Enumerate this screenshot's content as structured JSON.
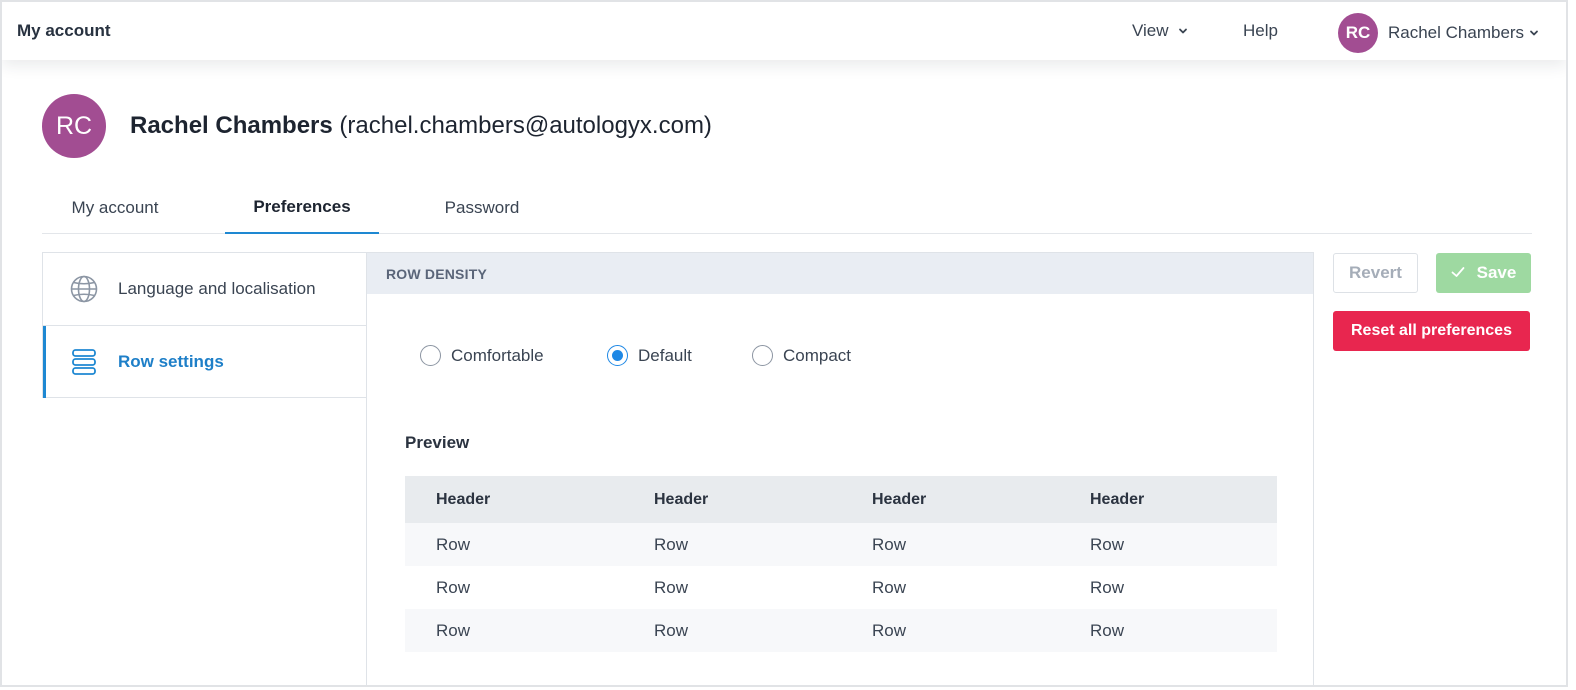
{
  "topbar": {
    "title": "My account",
    "view_label": "View",
    "help_label": "Help",
    "user_initials": "RC",
    "user_name": "Rachel Chambers"
  },
  "profile": {
    "initials": "RC",
    "name": "Rachel Chambers",
    "email": "(rachel.chambers@autologyx.com)"
  },
  "tabs": [
    {
      "label": "My account",
      "active": false
    },
    {
      "label": "Preferences",
      "active": true
    },
    {
      "label": "Password",
      "active": false
    }
  ],
  "sidebar": {
    "items": [
      {
        "label": "Language and localisation",
        "icon": "globe-icon",
        "active": false
      },
      {
        "label": "Row settings",
        "icon": "rows-icon",
        "active": true
      }
    ]
  },
  "panel": {
    "header": "ROW DENSITY",
    "options": [
      {
        "label": "Comfortable",
        "checked": false
      },
      {
        "label": "Default",
        "checked": true
      },
      {
        "label": "Compact",
        "checked": false
      }
    ],
    "preview_label": "Preview",
    "table": {
      "headers": [
        "Header",
        "Header",
        "Header",
        "Header"
      ],
      "rows": [
        [
          "Row",
          "Row",
          "Row",
          "Row"
        ],
        [
          "Row",
          "Row",
          "Row",
          "Row"
        ],
        [
          "Row",
          "Row",
          "Row",
          "Row"
        ]
      ]
    }
  },
  "actions": {
    "revert_label": "Revert",
    "save_label": "Save",
    "reset_label": "Reset all preferences"
  },
  "colors": {
    "accent": "#1e88d2",
    "avatar": "#a24d92",
    "save": "#9ed9a1",
    "danger": "#e8264f"
  }
}
